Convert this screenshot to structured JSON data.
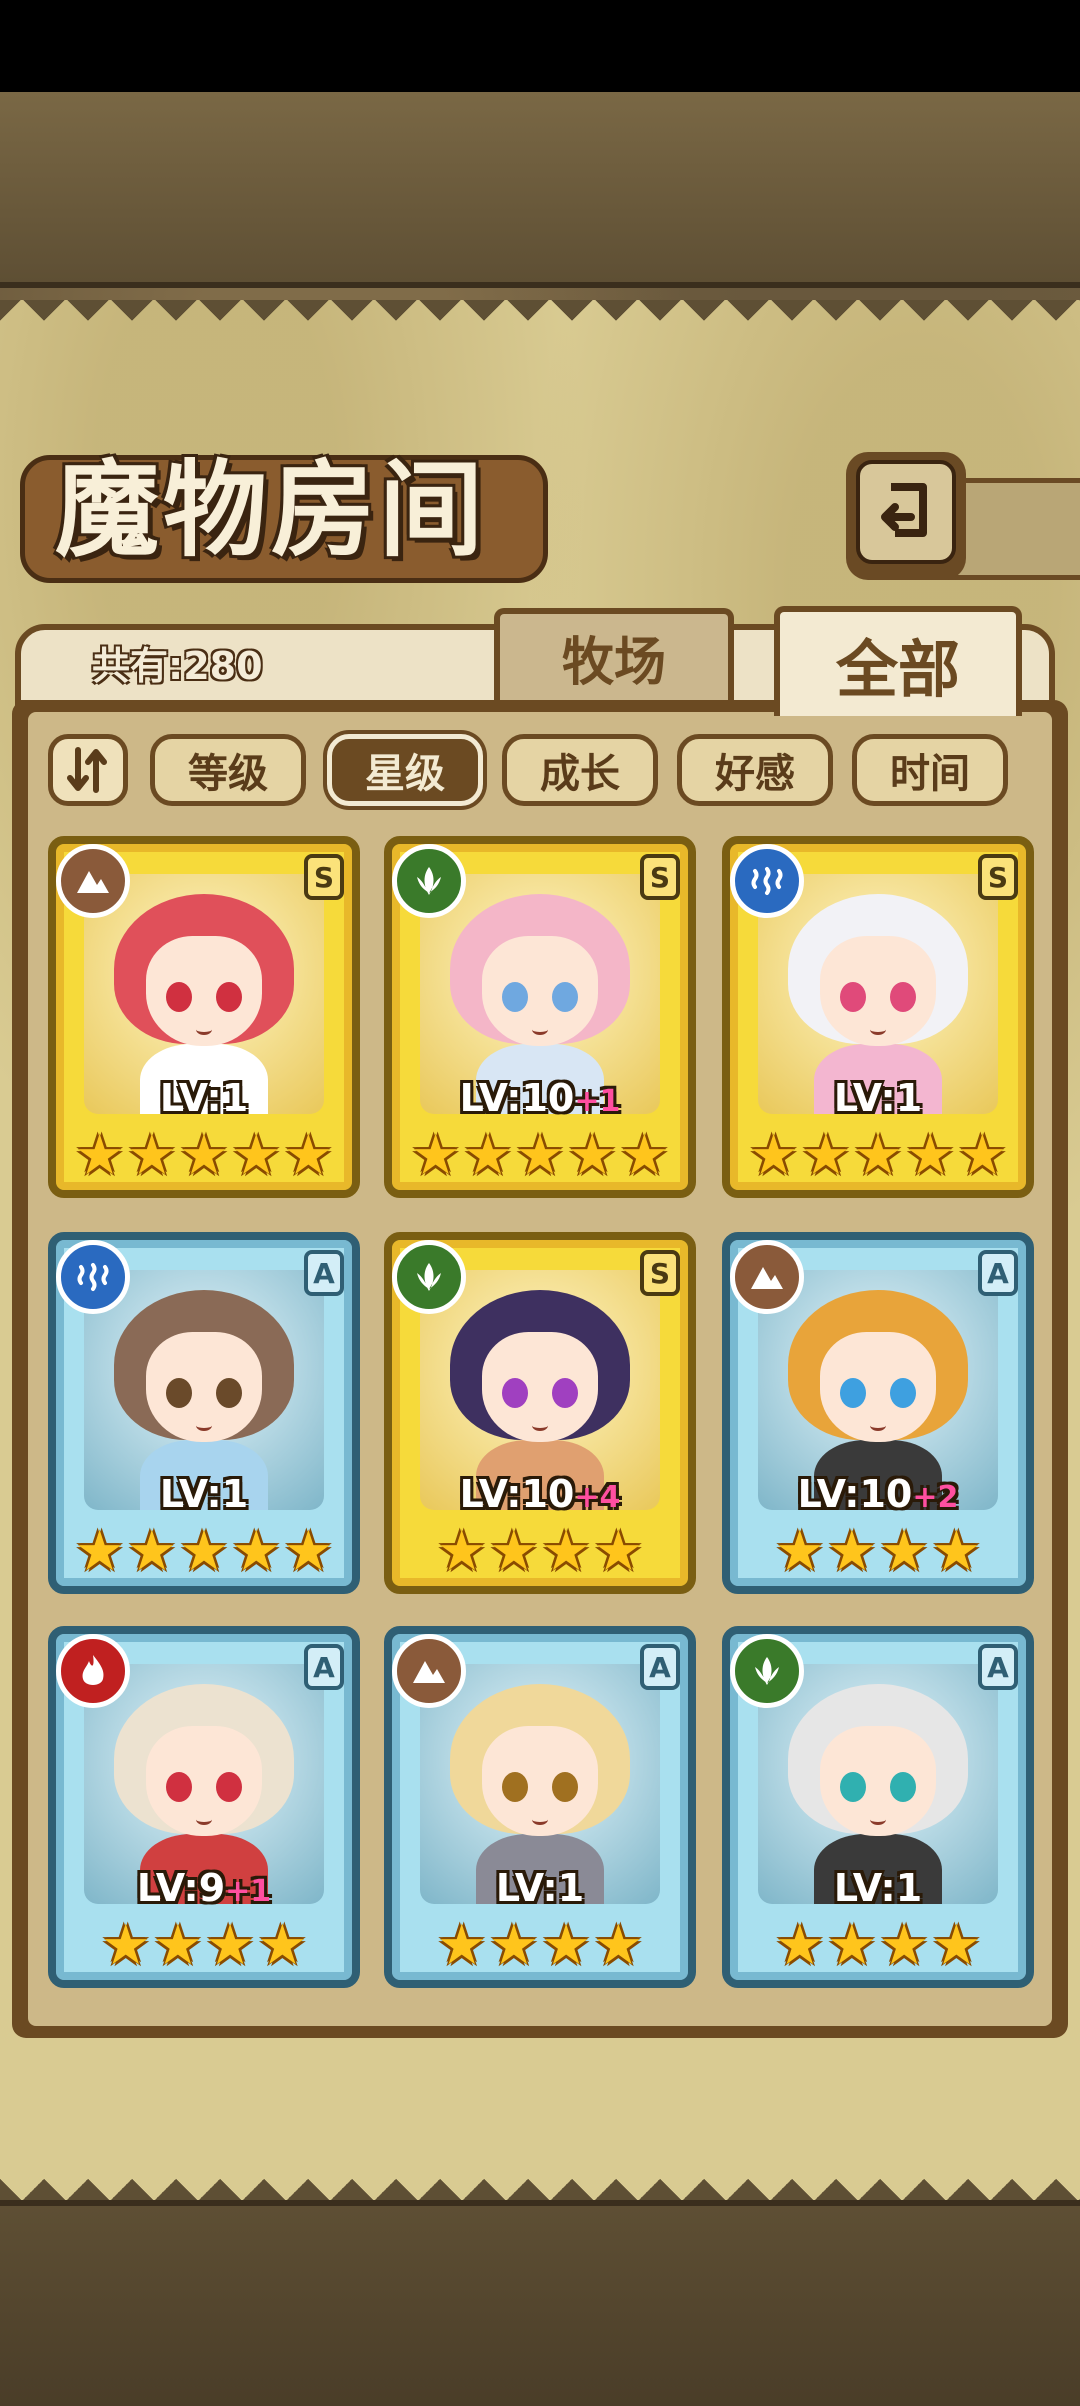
{
  "title": "魔物房间",
  "count_label": "共有:280",
  "tabs": [
    {
      "label": "牧场",
      "active": false
    },
    {
      "label": "全部",
      "active": true
    }
  ],
  "sort_buttons": [
    {
      "label": "等级",
      "active": false
    },
    {
      "label": "星级",
      "active": true
    },
    {
      "label": "成长",
      "active": false
    },
    {
      "label": "好感",
      "active": false
    },
    {
      "label": "时间",
      "active": false
    }
  ],
  "monsters": [
    {
      "rank": "S",
      "frame": "gold",
      "element": "earth",
      "level": "LV:1",
      "bonus": "",
      "stars": 5,
      "hair": "#e0505a",
      "eyes": "#d03040",
      "outfit": "#ffffff"
    },
    {
      "rank": "S",
      "frame": "gold",
      "element": "wind",
      "level": "LV:10",
      "bonus": "+1",
      "stars": 5,
      "hair": "#f4b6c8",
      "eyes": "#6fa8e0",
      "outfit": "#d8e6f4"
    },
    {
      "rank": "S",
      "frame": "gold",
      "element": "water",
      "level": "LV:1",
      "bonus": "",
      "stars": 5,
      "hair": "#f2f2f6",
      "eyes": "#e04a7a",
      "outfit": "#f3b6d0"
    },
    {
      "rank": "A",
      "frame": "blue",
      "element": "water",
      "level": "LV:1",
      "bonus": "",
      "stars": 5,
      "hair": "#8a6a56",
      "eyes": "#6a4a2a",
      "outfit": "#a8d4ee"
    },
    {
      "rank": "S",
      "frame": "gold",
      "element": "wind",
      "level": "LV:10",
      "bonus": "+4",
      "stars": 4,
      "hair": "#3e3060",
      "eyes": "#a040c0",
      "outfit": "#e0a070"
    },
    {
      "rank": "A",
      "frame": "blue",
      "element": "earth",
      "level": "LV:10",
      "bonus": "+2",
      "stars": 4,
      "hair": "#e8a43a",
      "eyes": "#3ea0e0",
      "outfit": "#3a3a3a"
    },
    {
      "rank": "A",
      "frame": "blue",
      "element": "fire",
      "level": "LV:9",
      "bonus": "+1",
      "stars": 4,
      "hair": "#ece2d0",
      "eyes": "#d03040",
      "outfit": "#d04040"
    },
    {
      "rank": "A",
      "frame": "blue",
      "element": "earth",
      "level": "LV:1",
      "bonus": "",
      "stars": 4,
      "hair": "#f0d89a",
      "eyes": "#a07020",
      "outfit": "#8a8a96"
    },
    {
      "rank": "A",
      "frame": "blue",
      "element": "wind",
      "level": "LV:1",
      "bonus": "",
      "stars": 4,
      "hair": "#e6e6e6",
      "eyes": "#30b0b0",
      "outfit": "#3a3a3a"
    }
  ],
  "element_colors": {
    "earth": "#8a5a3a",
    "wind": "#3a7a2a",
    "water": "#2a6ac0",
    "fire": "#c02020"
  }
}
